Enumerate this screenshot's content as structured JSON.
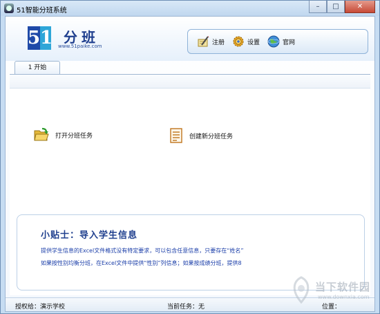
{
  "window": {
    "title": "51智能分班系统",
    "controls": {
      "minimize": "–",
      "maximize": "□",
      "close": "✕"
    }
  },
  "header": {
    "logo_digit_1": "5",
    "logo_digit_2": "1",
    "logo_title": "分班",
    "logo_url": "www.51paike.com",
    "toolbar": [
      {
        "label": "注册",
        "icon": "register-icon"
      },
      {
        "label": "设置",
        "icon": "settings-gear-icon"
      },
      {
        "label": "官网",
        "icon": "globe-icon"
      }
    ]
  },
  "tabs": [
    {
      "label": "1 开始"
    }
  ],
  "actions": [
    {
      "label": "打开分班任务",
      "icon": "open-folder-icon"
    },
    {
      "label": "创建新分班任务",
      "icon": "new-document-icon"
    }
  ],
  "tips": {
    "title": "小贴士：导入学生信息",
    "lines": [
      "提供学生信息的Excel文件格式没有特定要求，可以包含任意信息，只要存在“姓名”",
      "如果按性别均衡分班，在Excel文件中提供“性别”列信息；如果按成绩分班，提供8"
    ]
  },
  "status": {
    "license": "授权给：演示学校",
    "current_task": "当前任务：无",
    "position": "位置："
  },
  "watermark": {
    "text": "当下软件园",
    "url": "www.downxia.com"
  }
}
